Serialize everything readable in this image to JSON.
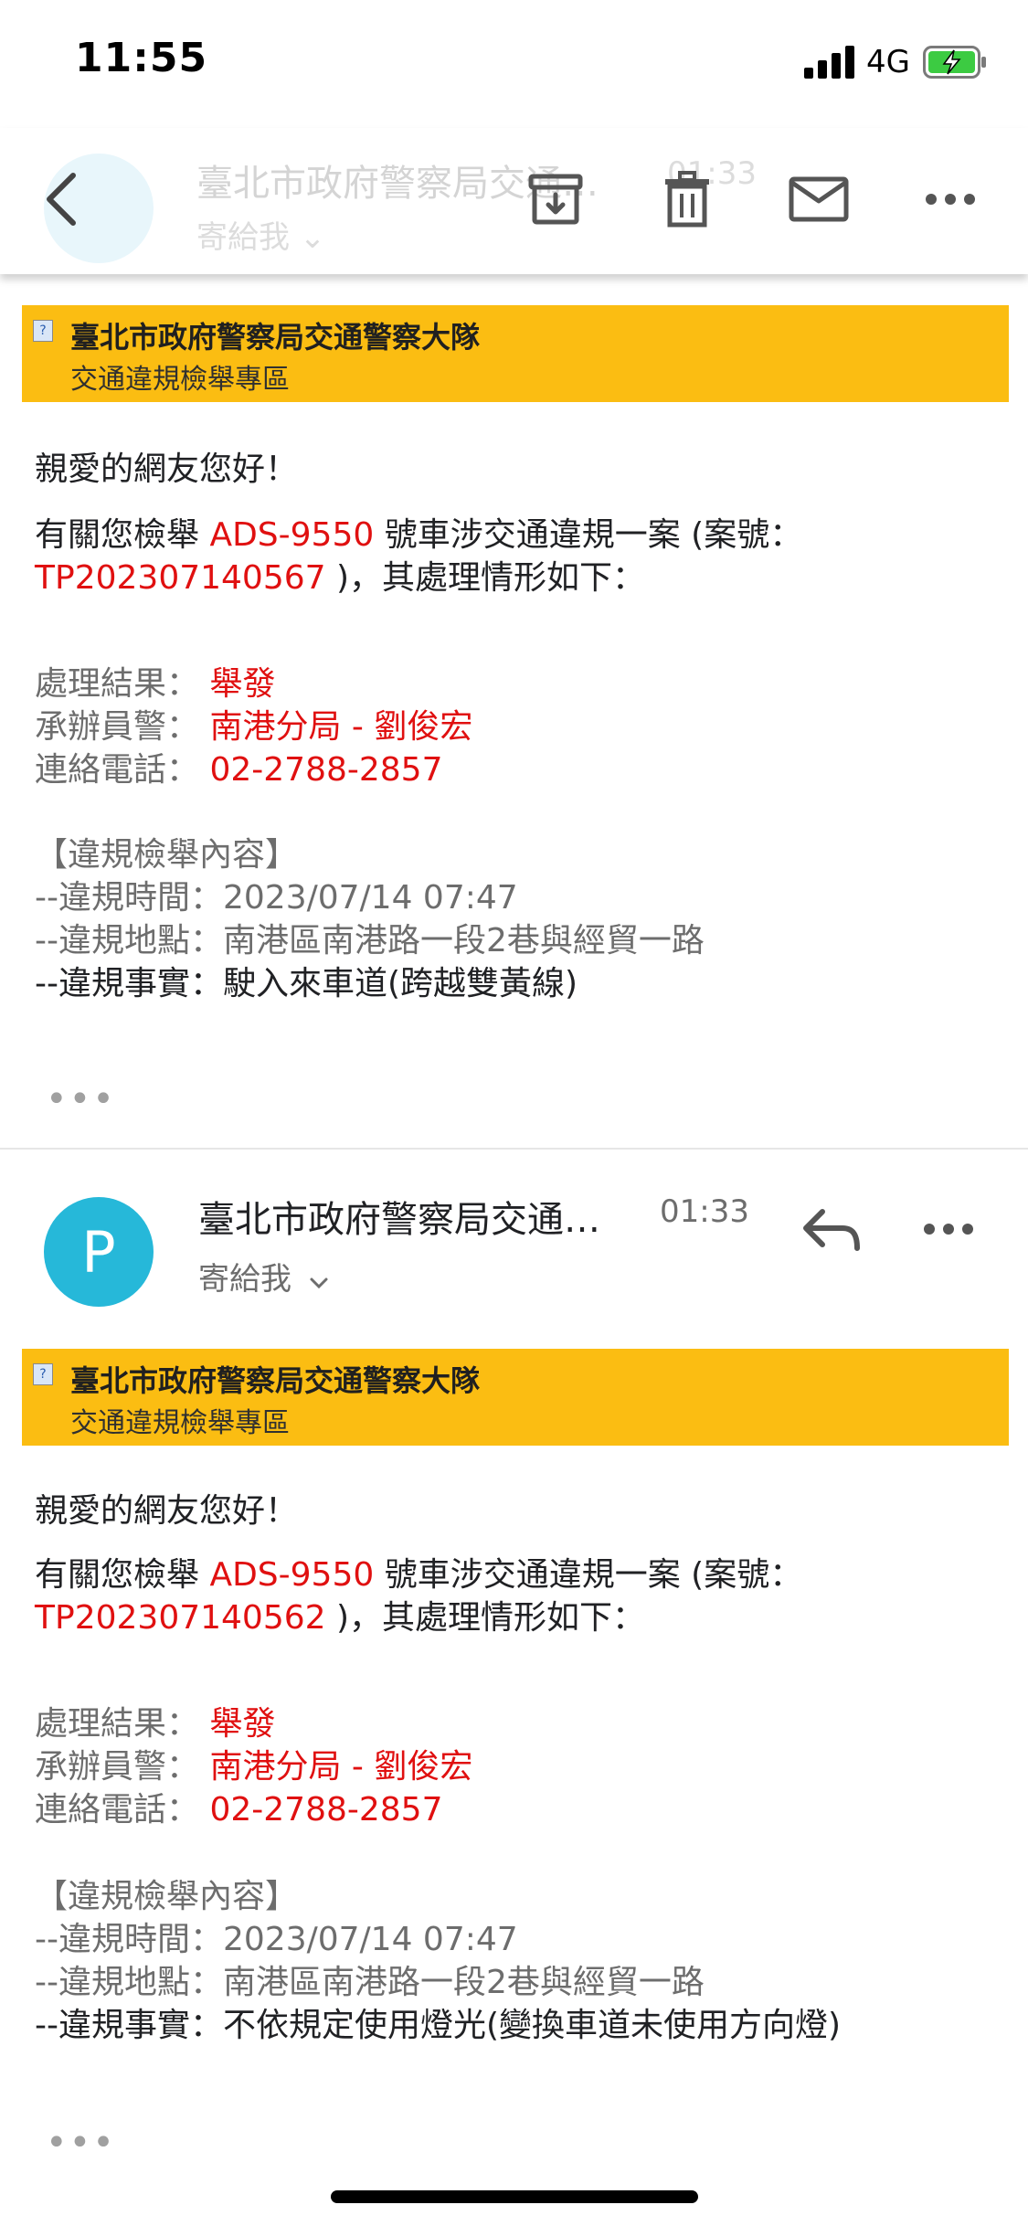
{
  "status_bar": {
    "time": "11:55",
    "network": "4G"
  },
  "toolbar": {
    "faded_sender_title": "臺北市政府警察局交通…",
    "faded_to_me": "寄給我 ⌄",
    "faded_time": "01:33",
    "icons": [
      "back-icon",
      "archive-icon",
      "trash-icon",
      "mail-icon",
      "more-icon"
    ]
  },
  "emails": [
    {
      "banner_title": "臺北市政府警察局交通警察大隊",
      "banner_subtitle": "交通違規檢舉專區",
      "greeting": "親愛的網友您好！",
      "intro_prefix": "有關您檢舉 ",
      "plate": "ADS-9550",
      "intro_middle": " 號車涉交通違規一案 (案號：",
      "case_no": "TP202307140567",
      "intro_suffix": "  )，其處理情形如下：",
      "result_label": "處理結果：",
      "result_value": "舉發",
      "officer_label": "承辦員警：",
      "officer_value": "南港分局 - 劉俊宏",
      "phone_label": "連絡電話：",
      "phone_value": "02-2788-2857",
      "content_header": "【違規檢舉內容】",
      "time_line": "--違規時間：2023/07/14 07:47",
      "location_line": "--違規地點：南港區南港路一段2巷與經貿一路",
      "fact_line": "--違規事實：駛入來車道(跨越雙黃線)"
    },
    {
      "sender": "臺北市政府警察局交通…",
      "time": "01:33",
      "to_me": "寄給我",
      "avatar_letter": "P",
      "banner_title": "臺北市政府警察局交通警察大隊",
      "banner_subtitle": "交通違規檢舉專區",
      "greeting": "親愛的網友您好！",
      "intro_prefix": "有關您檢舉 ",
      "plate": "ADS-9550",
      "intro_middle": " 號車涉交通違規一案 (案號：",
      "case_no": "TP202307140562",
      "intro_suffix": "  )，其處理情形如下：",
      "result_label": "處理結果：",
      "result_value": "舉發",
      "officer_label": "承辦員警：",
      "officer_value": "南港分局 - 劉俊宏",
      "phone_label": "連絡電話：",
      "phone_value": "02-2788-2857",
      "content_header": "【違規檢舉內容】",
      "time_line": "--違規時間：2023/07/14 07:47",
      "location_line": "--違規地點：南港區南港路一段2巷與經貿一路",
      "fact_line": "--違規事實：不依規定使用燈光(變換車道未使用方向燈)"
    }
  ],
  "colors": {
    "banner": "#fbbd12",
    "highlight_red": "#e01010",
    "avatar": "#26b8d9"
  },
  "ellipsis": "•••"
}
